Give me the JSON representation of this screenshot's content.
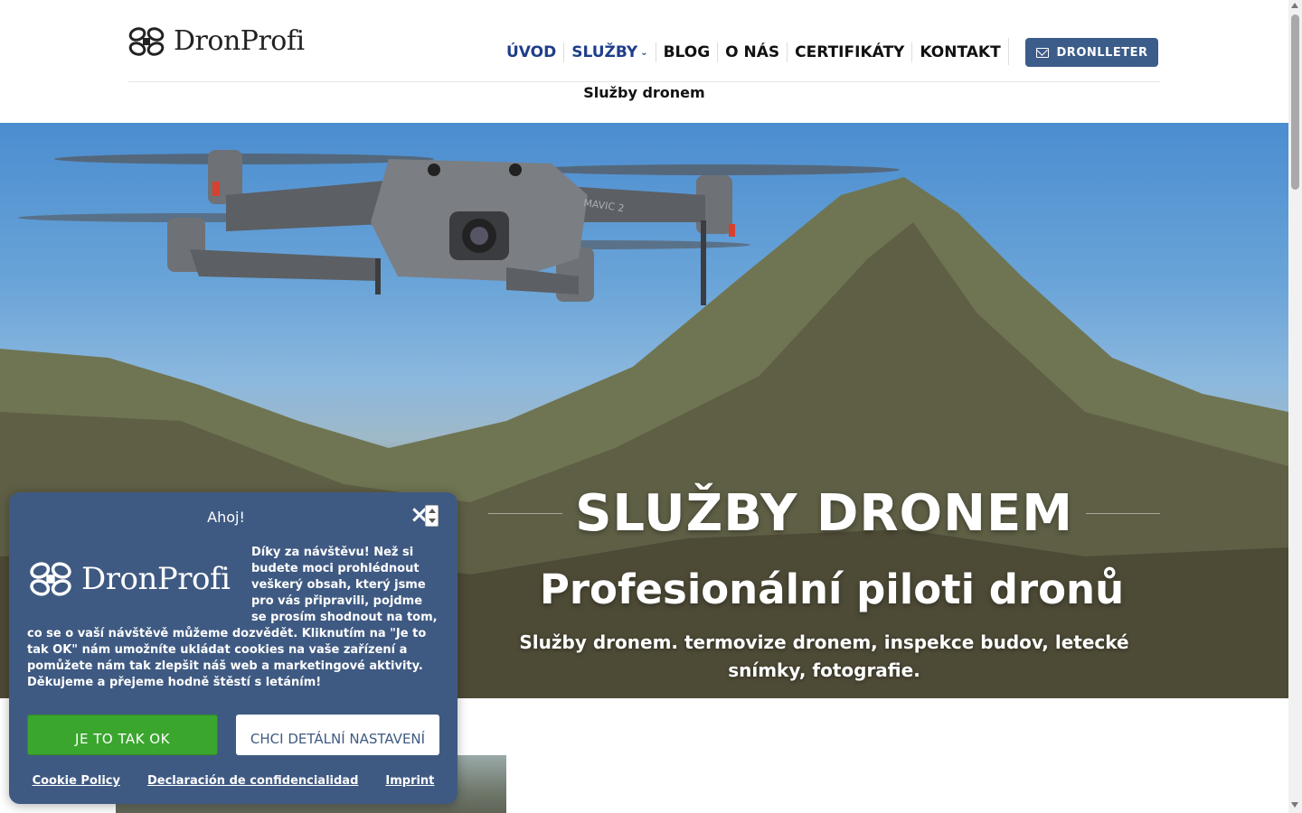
{
  "brand": {
    "name": "DronProfi",
    "logo_icon": "drone-propeller-logo-icon"
  },
  "nav": {
    "items": [
      {
        "label": "ÚVOD",
        "active": true
      },
      {
        "label": "SLUŽBY",
        "active": true,
        "has_dropdown": true
      },
      {
        "label": "BLOG",
        "active": false
      },
      {
        "label": "O NÁS",
        "active": false
      },
      {
        "label": "CERTIFIKÁTY",
        "active": false
      },
      {
        "label": "KONTAKT",
        "active": false
      }
    ],
    "dropdown_icon": "chevron-down-icon",
    "newsletter_label": "DRONLLETER",
    "newsletter_icon": "envelope-icon"
  },
  "breadcrumb": "Služby dronem",
  "hero": {
    "title": "SLUŽBY DRONEM",
    "subtitle": "Profesionální piloti dronů",
    "description": "Služby dronem. termovize dronem, inspekce budov, letecké snímky, fotografie.",
    "drone_model_text": "MAVIC 2"
  },
  "cookie": {
    "title": "Ahoj!",
    "close_icon": "close-icon",
    "logo_text": "DronProfi",
    "message": "Díky za návštěvu! Než si budete moci prohlédnout veškerý obsah, který jsme pro vás připravili, pojdme se prosím shodnout na tom, co se o vaší návštěvě můžeme dozvědět. Kliknutím na \"Je to tak OK\" nám umožníte ukládat cookies na vaše zařízení a pomůžete nám tak zlepšit náš web a marketingové aktivity. Děkujeme a přejeme hodně štěstí s letáním!",
    "accept_label": "JE TO TAK OK",
    "details_label": "CHCI DETÁLNÍ NASTAVENÍ",
    "links": [
      "Cookie Policy",
      "Declaración de confidencialidad",
      "Imprint"
    ]
  },
  "colors": {
    "nav_active": "#1f3e8a",
    "newsletter_button": "#3c5c8a",
    "cookie_background": "#3f5a82",
    "accept_button": "#3aa62e"
  }
}
